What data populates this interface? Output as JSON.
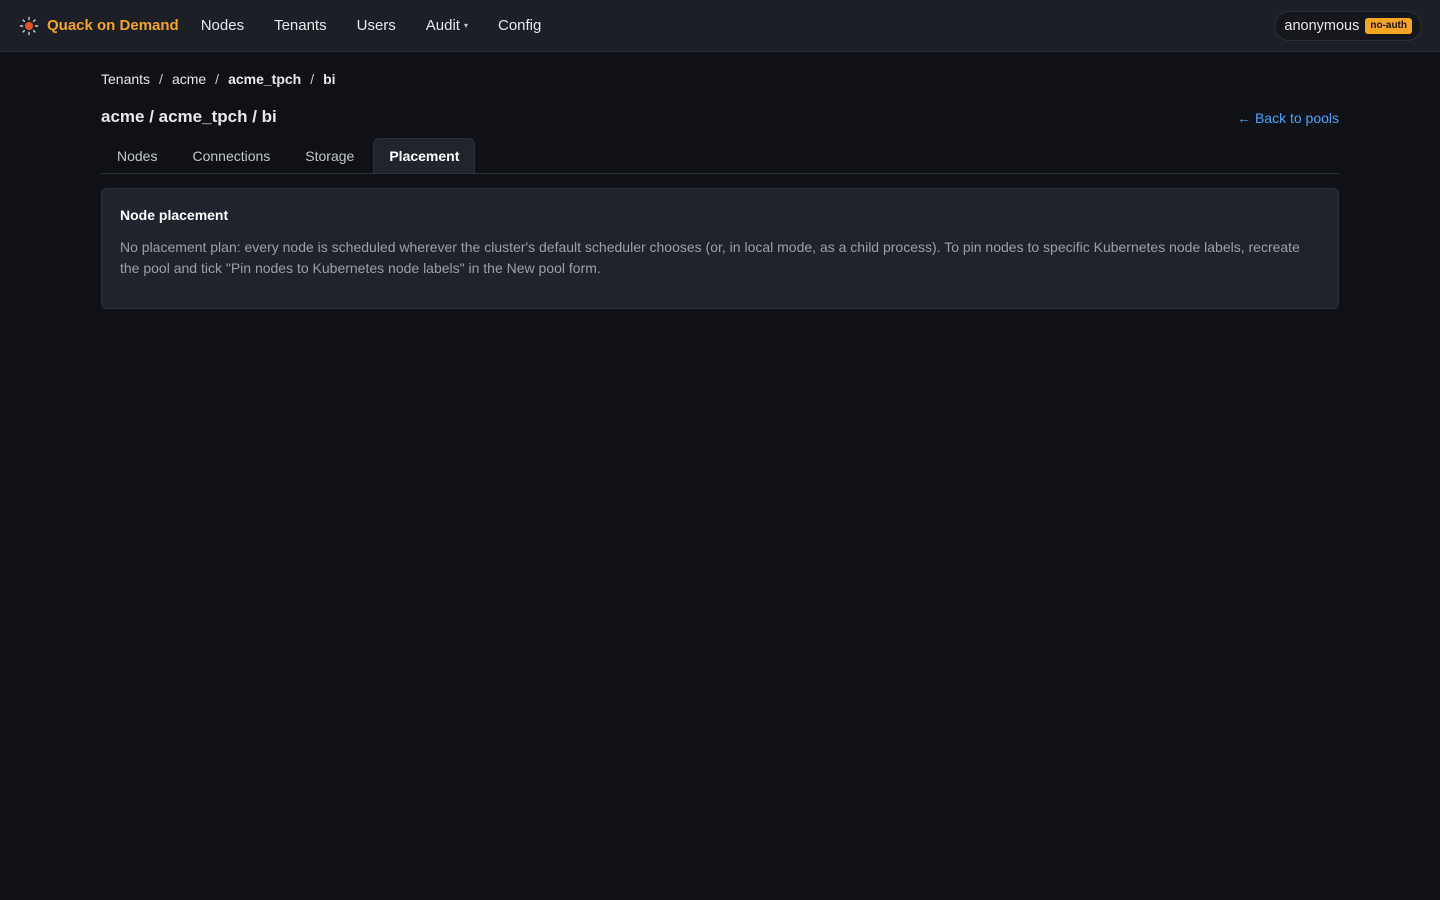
{
  "nav": {
    "brand": "Quack on Demand",
    "items": [
      {
        "label": "Nodes",
        "has_caret": false
      },
      {
        "label": "Tenants",
        "has_caret": false
      },
      {
        "label": "Users",
        "has_caret": false
      },
      {
        "label": "Audit",
        "has_caret": true
      },
      {
        "label": "Config",
        "has_caret": false
      }
    ],
    "caret": "▾",
    "user": "anonymous",
    "auth_badge": "no-auth"
  },
  "breadcrumb": {
    "items": [
      "Tenants",
      "acme",
      "acme_tpch",
      "bi"
    ],
    "separator": "/"
  },
  "page": {
    "title": "acme / acme_tpch / bi",
    "back_link": "← Back to pools"
  },
  "tabs": [
    {
      "label": "Nodes",
      "active": false
    },
    {
      "label": "Connections",
      "active": false
    },
    {
      "label": "Storage",
      "active": false
    },
    {
      "label": "Placement",
      "active": true
    }
  ],
  "card": {
    "title": "Node placement",
    "body": "No placement plan: every node is scheduled wherever the cluster's default scheduler chooses (or, in local mode, as a child process). To pin nodes to specific Kubernetes node labels, recreate the pool and tick \"Pin nodes to Kubernetes node labels\" in the New pool form."
  },
  "colors": {
    "accent": "#f5a524",
    "link": "#4aa3ff",
    "background": "#0f1116",
    "surface": "#1f232b"
  },
  "icons": {
    "brand": "sun-duck-icon"
  }
}
